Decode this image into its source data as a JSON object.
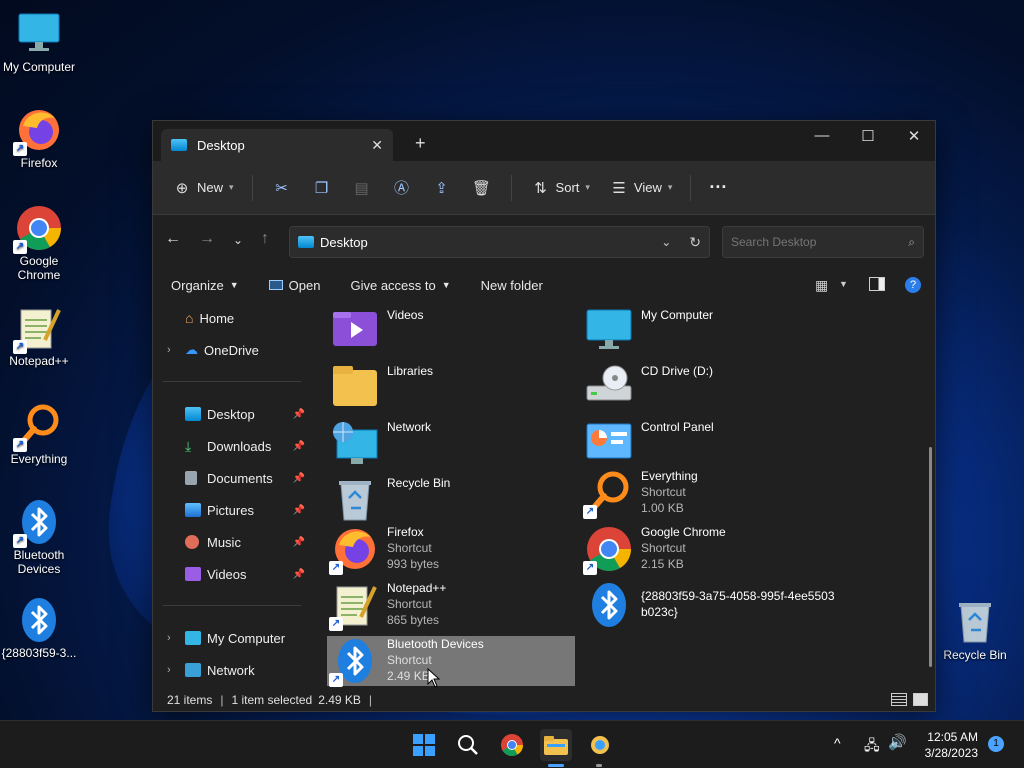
{
  "desktop": {
    "icons": [
      {
        "label": "My Computer"
      },
      {
        "label": "Firefox"
      },
      {
        "label": "Google Chrome"
      },
      {
        "label": "Notepad++"
      },
      {
        "label": "Everything"
      },
      {
        "label": "Bluetooth Devices"
      },
      {
        "label": "{28803f59-3..."
      },
      {
        "label": "Recycle Bin"
      }
    ]
  },
  "window": {
    "tab_title": "Desktop",
    "toolbar": {
      "new_label": "New",
      "sort_label": "Sort",
      "view_label": "View",
      "more_label": "···"
    },
    "address": "Desktop",
    "search_placeholder": "Search Desktop",
    "cmdbar": {
      "organize": "Organize",
      "open": "Open",
      "give_access": "Give access to",
      "new_folder": "New folder"
    },
    "sidebar": {
      "home": "Home",
      "onedrive": "OneDrive",
      "quick": [
        "Desktop",
        "Downloads",
        "Documents",
        "Pictures",
        "Music",
        "Videos"
      ],
      "my_computer": "My Computer",
      "network": "Network"
    },
    "files": [
      {
        "name": "Videos",
        "type": "",
        "size": ""
      },
      {
        "name": "My Computer",
        "type": "",
        "size": ""
      },
      {
        "name": "Libraries",
        "type": "",
        "size": ""
      },
      {
        "name": "CD Drive (D:)",
        "type": "",
        "size": ""
      },
      {
        "name": "Network",
        "type": "",
        "size": ""
      },
      {
        "name": "Control Panel",
        "type": "",
        "size": ""
      },
      {
        "name": "Recycle Bin",
        "type": "",
        "size": ""
      },
      {
        "name": "Everything",
        "type": "Shortcut",
        "size": "1.00 KB"
      },
      {
        "name": "Firefox",
        "type": "Shortcut",
        "size": "993 bytes"
      },
      {
        "name": "Google Chrome",
        "type": "Shortcut",
        "size": "2.15 KB"
      },
      {
        "name": "Notepad++",
        "type": "Shortcut",
        "size": "865 bytes"
      },
      {
        "name": "{28803f59-3a75-4058-995f-4ee5503",
        "type": "b023c}",
        "size": ""
      },
      {
        "name": "Bluetooth Devices",
        "type": "Shortcut",
        "size": "2.49 KB"
      }
    ],
    "status": {
      "items": "21 items",
      "selected": "1 item selected",
      "size": "2.49 KB"
    }
  },
  "taskbar": {
    "time": "12:05 AM",
    "date": "3/28/2023",
    "notification_count": "1"
  },
  "colors": {
    "accent": "#4aa3ff",
    "selection": "#777777"
  }
}
